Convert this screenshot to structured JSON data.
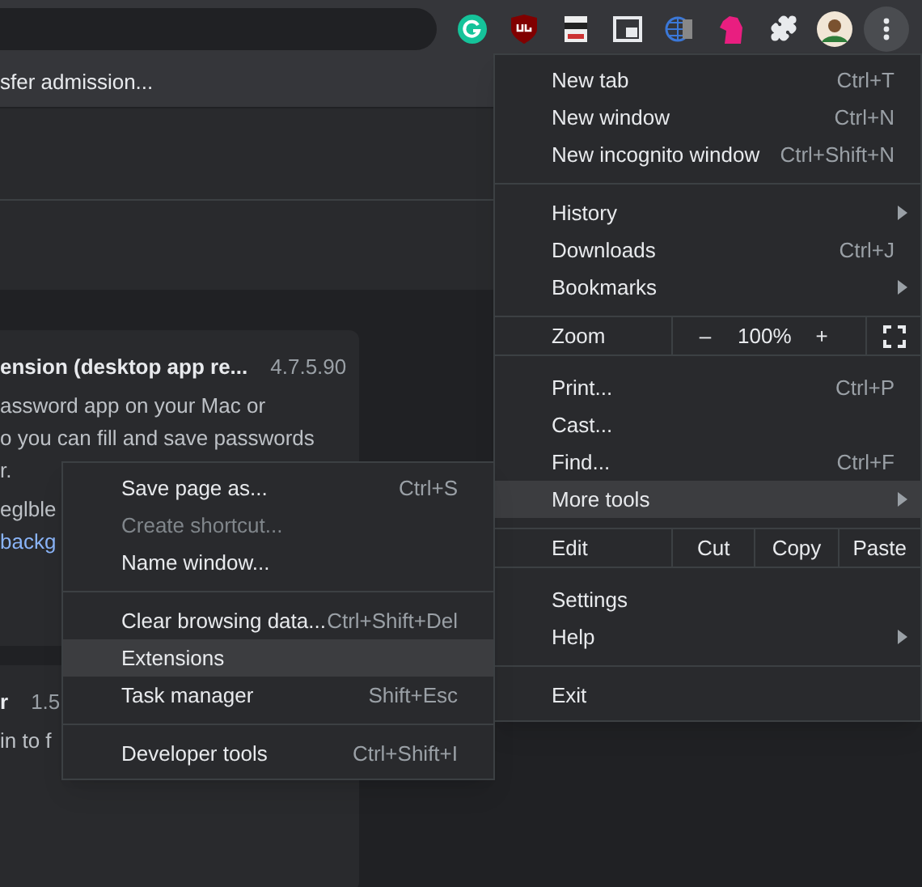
{
  "bookmarks_bar": {
    "items": [
      "sfer admission..."
    ]
  },
  "page": {
    "cards": [
      {
        "title": "ension (desktop app re...",
        "version": "4.7.5.90",
        "lines": [
          "assword app on your Mac or",
          "o you can fill and save passwords",
          "r."
        ],
        "id_text": "eglble",
        "link": "backg"
      },
      {
        "title": "r",
        "version": "1.5",
        "lines": [
          "in to f"
        ]
      }
    ]
  },
  "main_menu": {
    "sections": [
      [
        {
          "kind": "item",
          "label": "New tab",
          "shortcut": "Ctrl+T",
          "has_submenu": false,
          "selected": false
        },
        {
          "kind": "item",
          "label": "New window",
          "shortcut": "Ctrl+N",
          "has_submenu": false,
          "selected": false
        },
        {
          "kind": "item",
          "label": "New incognito window",
          "shortcut": "Ctrl+Shift+N",
          "has_submenu": false,
          "selected": false
        }
      ],
      [
        {
          "kind": "item",
          "label": "History",
          "has_submenu": true,
          "selected": false
        },
        {
          "kind": "item",
          "label": "Downloads",
          "shortcut": "Ctrl+J",
          "has_submenu": false,
          "selected": false
        },
        {
          "kind": "item",
          "label": "Bookmarks",
          "has_submenu": true,
          "selected": false
        }
      ],
      [
        {
          "kind": "zoom",
          "label": "Zoom",
          "minus": "–",
          "value": "100%",
          "plus": "+"
        }
      ],
      [
        {
          "kind": "item",
          "label": "Print...",
          "shortcut": "Ctrl+P",
          "has_submenu": false,
          "selected": false
        },
        {
          "kind": "item",
          "label": "Cast...",
          "has_submenu": false,
          "selected": false
        },
        {
          "kind": "item",
          "label": "Find...",
          "shortcut": "Ctrl+F",
          "has_submenu": false,
          "selected": false
        },
        {
          "kind": "item",
          "label": "More tools",
          "has_submenu": true,
          "selected": true
        }
      ],
      [
        {
          "kind": "edit",
          "label": "Edit",
          "buttons": [
            "Cut",
            "Copy",
            "Paste"
          ]
        }
      ],
      [
        {
          "kind": "item",
          "label": "Settings",
          "has_submenu": false,
          "selected": false
        },
        {
          "kind": "item",
          "label": "Help",
          "has_submenu": true,
          "selected": false
        }
      ],
      [
        {
          "kind": "item",
          "label": "Exit",
          "has_submenu": false,
          "selected": false
        }
      ]
    ]
  },
  "more_tools_menu": {
    "sections": [
      [
        {
          "label": "Save page as...",
          "shortcut": "Ctrl+S",
          "disabled": false,
          "selected": false
        },
        {
          "label": "Create shortcut...",
          "disabled": true,
          "selected": false
        },
        {
          "label": "Name window...",
          "disabled": false,
          "selected": false
        }
      ],
      [
        {
          "label": "Clear browsing data...",
          "shortcut": "Ctrl+Shift+Del",
          "disabled": false,
          "selected": false
        },
        {
          "label": "Extensions",
          "disabled": false,
          "selected": true
        },
        {
          "label": "Task manager",
          "shortcut": "Shift+Esc",
          "disabled": false,
          "selected": false
        }
      ],
      [
        {
          "label": "Developer tools",
          "shortcut": "Ctrl+Shift+I",
          "disabled": false,
          "selected": false
        }
      ]
    ]
  }
}
